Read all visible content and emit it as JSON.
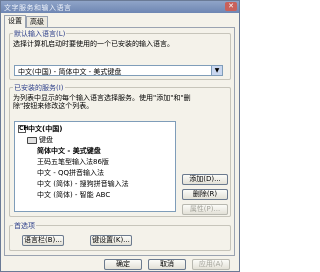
{
  "window": {
    "title": "文字服务和输入语言",
    "close_glyph": "✕"
  },
  "tabs": [
    {
      "label": "设置"
    },
    {
      "label": "高级"
    }
  ],
  "default_language": {
    "group_label": "默认输入语言(L)",
    "description": "选择计算机启动时要使用的一个已安装的输入语言。",
    "selected": "中文(中国) - 简体中文 - 美式键盘"
  },
  "installed_services": {
    "group_label": "已安装的服务(I)",
    "description_1": "为列表中显示的每个输入语言选择服务。使用\"添加\"和\"删",
    "description_2": "除\"按钮来修改这个列表。",
    "tree": {
      "language": "中文(中国)",
      "keyboard_label": "键盘",
      "items": [
        "简体中文 - 美式键盘",
        "王码五笔型输入法86版",
        "中文 - QQ拼音输入法",
        "中文 (简体) - 搜狗拼音输入法",
        "中文 (简体) - 智能 ABC"
      ]
    },
    "buttons": {
      "add": "添加(D)...",
      "remove": "删除(R)",
      "properties": "属性(P)..."
    }
  },
  "preferences": {
    "group_label": "首选项",
    "language_bar": "语言栏(B)...",
    "key_settings": "键设置(K)..."
  },
  "footer": {
    "ok": "确定",
    "cancel": "取消",
    "apply": "应用(A)"
  }
}
